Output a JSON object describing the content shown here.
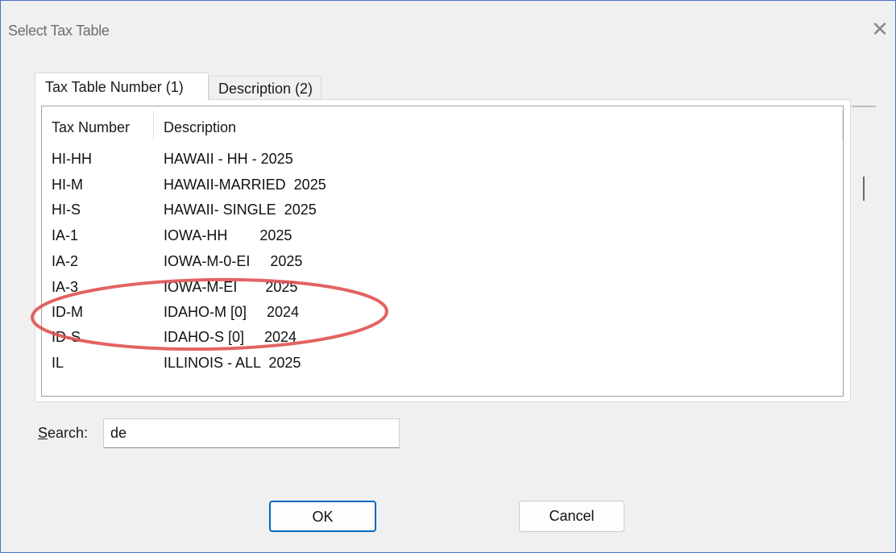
{
  "window": {
    "title": "Select Tax Table",
    "close_icon": "close-icon"
  },
  "tabs": [
    {
      "label": "Tax Table Number (1)",
      "active": true
    },
    {
      "label": "Description (2)",
      "active": false
    }
  ],
  "table": {
    "headers": {
      "number": "Tax Number",
      "description": "Description"
    },
    "rows": [
      {
        "number": "HI-HH",
        "description": "HAWAII - HH - 2025"
      },
      {
        "number": "HI-M",
        "description": "HAWAII-MARRIED  2025"
      },
      {
        "number": "HI-S",
        "description": "HAWAII- SINGLE  2025"
      },
      {
        "number": "IA-1",
        "description": "IOWA-HH        2025"
      },
      {
        "number": "IA-2",
        "description": "IOWA-M-0-EI     2025"
      },
      {
        "number": "IA-3",
        "description": "IOWA-M-EI       2025"
      },
      {
        "number": "ID-M",
        "description": "IDAHO-M [0]     2024"
      },
      {
        "number": "ID-S",
        "description": "IDAHO-S [0]     2024"
      },
      {
        "number": "IL",
        "description": "ILLINOIS - ALL  2025"
      }
    ]
  },
  "search": {
    "label_underlined": "S",
    "label_rest": "earch:",
    "value": "de"
  },
  "buttons": {
    "ok": "OK",
    "cancel": "Cancel"
  },
  "annotation": {
    "color": "#e05252",
    "highlighted_rows": [
      "ID-M",
      "ID-S"
    ]
  }
}
